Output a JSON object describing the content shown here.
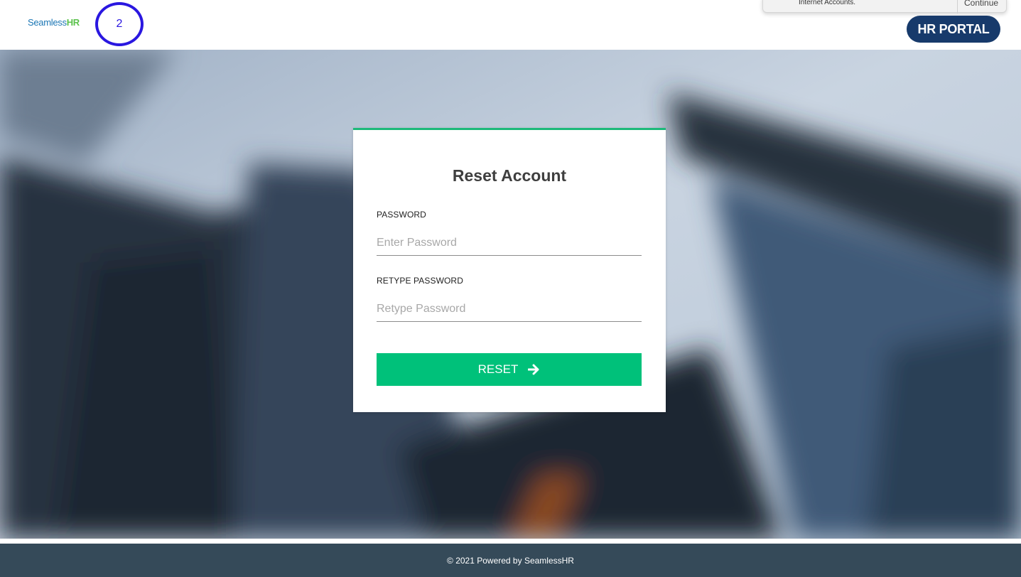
{
  "header": {
    "logo_seamless": "Seamless",
    "logo_hr": "HR",
    "step_number": "2",
    "portal_button": "HR PORTAL"
  },
  "popup": {
    "message": "Internet Accounts.",
    "continue_label": "Continue"
  },
  "form": {
    "title": "Reset Account",
    "password_label": "PASSWORD",
    "password_placeholder": "Enter Password",
    "retype_label": "RETYPE PASSWORD",
    "retype_placeholder": "Retype Password",
    "submit_label": "RESET",
    "submit_icon": "arrow-right-icon"
  },
  "footer": {
    "text": "© 2021 Powered by SeamlessHR"
  },
  "colors": {
    "accent_green": "#00c17a",
    "card_top_border": "#1db97a",
    "portal_button_bg": "#173a6b",
    "footer_bg": "#354a59",
    "step_circle": "#2a17e0"
  }
}
